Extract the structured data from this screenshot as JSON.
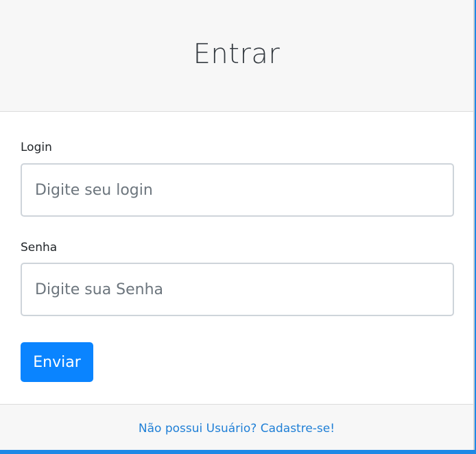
{
  "header": {
    "title": "Entrar"
  },
  "form": {
    "login": {
      "label": "Login",
      "placeholder": "Digite seu login",
      "value": ""
    },
    "password": {
      "label": "Senha",
      "placeholder": "Digite sua Senha",
      "value": ""
    },
    "submit_label": "Enviar"
  },
  "footer": {
    "register_link": "Não possui Usuário? Cadastre-se!"
  },
  "colors": {
    "accent": "#0a84ff",
    "link": "#1f7fd6",
    "header_bg": "#f7f7f7"
  }
}
